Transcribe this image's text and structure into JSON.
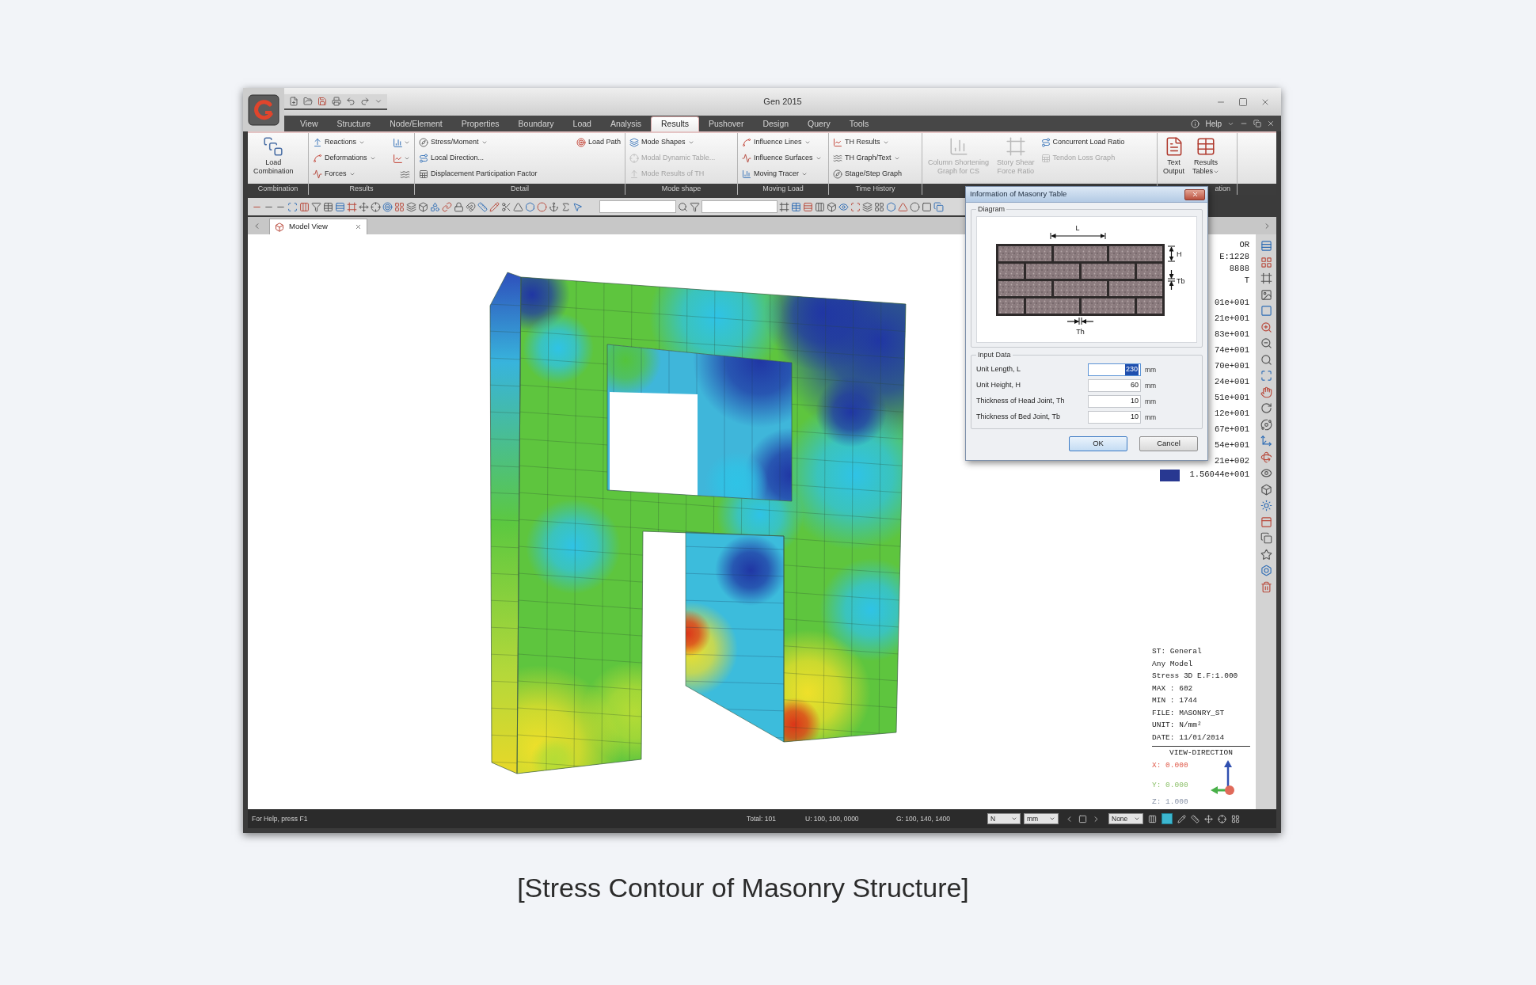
{
  "window": {
    "title": "Gen 2015"
  },
  "menu_tabs": [
    {
      "label": "View",
      "selected": false
    },
    {
      "label": "Structure",
      "selected": false
    },
    {
      "label": "Node/Element",
      "selected": false
    },
    {
      "label": "Properties",
      "selected": false
    },
    {
      "label": "Boundary",
      "selected": false
    },
    {
      "label": "Load",
      "selected": false
    },
    {
      "label": "Analysis",
      "selected": false
    },
    {
      "label": "Results",
      "selected": true
    },
    {
      "label": "Pushover",
      "selected": false
    },
    {
      "label": "Design",
      "selected": false
    },
    {
      "label": "Query",
      "selected": false
    },
    {
      "label": "Tools",
      "selected": false
    }
  ],
  "help": "Help",
  "ribbon_groups": [
    {
      "label": "Combination",
      "clipped": false,
      "items": [
        {
          "kind": "large",
          "label_lines": [
            "Load",
            "Combination"
          ],
          "dropdown": false,
          "disabled": false
        }
      ]
    },
    {
      "label": "Results",
      "clipped": false,
      "items": [
        {
          "kind": "small",
          "label": "Reactions",
          "dropdown": true,
          "disabled": false
        },
        {
          "kind": "small",
          "label": "Deformations",
          "dropdown": true,
          "disabled": false
        },
        {
          "kind": "small",
          "label": "Forces",
          "dropdown": true,
          "disabled": false
        },
        {
          "kind": "icon",
          "dropdown": true,
          "disabled": false
        },
        {
          "kind": "icon",
          "dropdown": true,
          "disabled": false
        },
        {
          "kind": "icon",
          "dropdown": false,
          "disabled": false
        }
      ]
    },
    {
      "label": "Detail",
      "clipped": false,
      "items": [
        {
          "kind": "small",
          "label": "Stress/Moment",
          "dropdown": true,
          "disabled": false
        },
        {
          "kind": "small",
          "label": "Local Direction...",
          "dropdown": false,
          "disabled": false
        },
        {
          "kind": "small",
          "label": "Displacement Participation Factor",
          "dropdown": false,
          "disabled": false
        },
        {
          "kind": "small",
          "label": "Load Path",
          "dropdown": false,
          "disabled": false
        }
      ]
    },
    {
      "label": "Mode shape",
      "clipped": false,
      "items": [
        {
          "kind": "small",
          "label": "Mode Shapes",
          "dropdown": true,
          "disabled": false
        },
        {
          "kind": "small",
          "label": "Modal Dynamic Table...",
          "dropdown": false,
          "disabled": true
        },
        {
          "kind": "small",
          "label": "Mode Results of TH",
          "dropdown": false,
          "disabled": true
        }
      ]
    },
    {
      "label": "Moving Load",
      "clipped": false,
      "items": [
        {
          "kind": "small",
          "label": "Influence Lines",
          "dropdown": true,
          "disabled": false
        },
        {
          "kind": "small",
          "label": "Influence Surfaces",
          "dropdown": true,
          "disabled": false
        },
        {
          "kind": "small",
          "label": "Moving Tracer",
          "dropdown": true,
          "disabled": false
        }
      ]
    },
    {
      "label": "Time History",
      "clipped": false,
      "items": [
        {
          "kind": "small",
          "label": "TH Results",
          "dropdown": true,
          "disabled": false
        },
        {
          "kind": "small",
          "label": "TH Graph/Text",
          "dropdown": true,
          "disabled": false
        },
        {
          "kind": "small",
          "label": "Stage/Step Graph",
          "dropdown": false,
          "disabled": false
        }
      ]
    },
    {
      "clipped": false,
      "items": [
        {
          "kind": "large",
          "label_lines": [
            "Column Shortening",
            "Graph for CS"
          ],
          "dropdown": false,
          "disabled": true
        },
        {
          "kind": "large",
          "label_lines": [
            "Story Shear",
            "Force Ratio"
          ],
          "dropdown": false,
          "disabled": true
        },
        {
          "kind": "small",
          "label": "Concurrent Load Ratio",
          "dropdown": false,
          "disabled": false
        },
        {
          "kind": "small",
          "label": "Tendon Loss Graph",
          "dropdown": false,
          "disabled": true
        }
      ]
    },
    {
      "label": "ation",
      "clipped": true,
      "items": [
        {
          "kind": "large",
          "label_lines": [
            "Text",
            "Output"
          ],
          "dropdown": false,
          "disabled": false
        },
        {
          "kind": "large",
          "label_lines": [
            "Results",
            "Tables"
          ],
          "dropdown": true,
          "disabled": false
        }
      ]
    }
  ],
  "doc_tabs": [
    {
      "label": "Model View",
      "selected": true
    }
  ],
  "dialog": {
    "title": "Information of Masonry Table",
    "diagram_group": "Diagram",
    "dimension_labels": {
      "length": "L",
      "height": "H",
      "bed_joint": "Tb",
      "head_joint": "Th"
    },
    "input_group": "Input Data",
    "fields": [
      {
        "label": "Unit Length, L",
        "value": "230",
        "unit": "mm",
        "focused": true
      },
      {
        "label": "Unit Height, H",
        "value": "60",
        "unit": "mm",
        "focused": false
      },
      {
        "label": "Thickness of Head Joint, Th",
        "value": "10",
        "unit": "mm",
        "focused": false
      },
      {
        "label": "Thickness of Bed Joint, Tb",
        "value": "10",
        "unit": "mm",
        "focused": false
      }
    ],
    "buttons": [
      {
        "label": "OK",
        "default": true
      },
      {
        "label": "Cancel",
        "default": false
      }
    ]
  },
  "legend": {
    "header": [
      "OR",
      "E:1228",
      "8888",
      "T"
    ],
    "values": [
      "01e+001",
      "21e+001",
      "83e+001",
      "74e+001",
      "70e+001",
      "24e+001",
      "51e+001",
      "12e+001",
      "67e+001",
      "54e+001",
      "21e+002"
    ],
    "min_value": "1.56044e+001"
  },
  "info": {
    "lines": [
      "ST: General",
      "Any Model",
      "Stress 3D E.F:1.000",
      "MAX : 602",
      "MIN : 1744",
      "FILE: MASONRY_ST",
      "UNIT: N/mm²",
      "DATE: 11/01/2014"
    ],
    "view_direction": "VIEW-DIRECTION",
    "axes": [
      {
        "label": "X: 0.000",
        "color": "#e05a4a"
      },
      {
        "label": "Y: 0.000",
        "color": "#8cc06a"
      },
      {
        "label": "Z: 1.000",
        "color": "#8a94a8"
      }
    ]
  },
  "status_bar": {
    "help": "For Help, press F1",
    "readouts": [
      "Total: 101",
      "U: 100, 100, 0000",
      "G: 100, 140, 1400"
    ],
    "force_unit": "N",
    "length_unit": "mm",
    "selection": "None"
  },
  "caption": "[Stress Contour of Masonry Structure]"
}
